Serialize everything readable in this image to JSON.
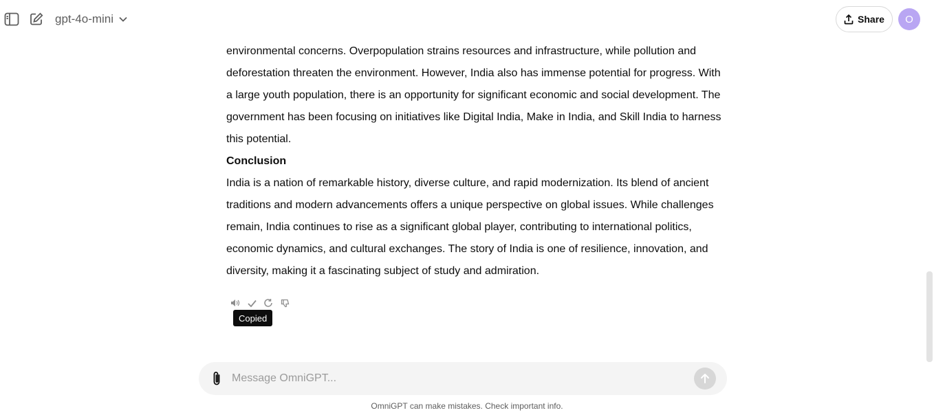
{
  "header": {
    "model_name": "gpt-4o-mini",
    "share_label": "Share",
    "avatar_initial": "O"
  },
  "message": {
    "paragraph1": "environmental concerns. Overpopulation strains resources and infrastructure, while pollution and deforestation threaten the environment. However, India also has immense potential for progress. With a large youth population, there is an opportunity for significant economic and social development. The government has been focusing on initiatives like Digital India, Make in India, and Skill India to harness this potential.",
    "heading": "Conclusion",
    "paragraph2": "India is a nation of remarkable history, diverse culture, and rapid modernization. Its blend of ancient traditions and modern advancements offers a unique perspective on global issues. While challenges remain, India continues to rise as a significant global player, contributing to international politics, economic dynamics, and cultural exchanges. The story of India is one of resilience, innovation, and diversity, making it a fascinating subject of study and admiration."
  },
  "actions": {
    "icons": [
      "speaker-icon",
      "check-icon",
      "regenerate-icon",
      "thumbs-down-icon"
    ],
    "tooltip": "Copied"
  },
  "composer": {
    "placeholder": "Message OmniGPT...",
    "value": ""
  },
  "footer": {
    "disclaimer": "OmniGPT can make mistakes. Check important info."
  },
  "colors": {
    "avatar": "#b9a6f3",
    "send_button": "#d7d7d7",
    "composer_bg": "#f4f4f4",
    "tooltip_bg": "#0d0d0d"
  }
}
